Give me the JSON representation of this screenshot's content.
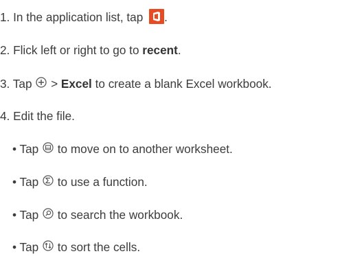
{
  "steps": [
    {
      "prefix": "1. In the application list, tap ",
      "suffix": ".",
      "icon": "office-icon"
    },
    {
      "prefix": "2. Flick left or right to go to ",
      "bold": "recent",
      "suffix": "."
    },
    {
      "prefix": "3. Tap ",
      "middle": " > ",
      "bold": "Excel",
      "suffix": " to create a blank Excel workbook.",
      "icon": "add-circle-icon"
    },
    {
      "text": "4. Edit the file."
    }
  ],
  "bullets": [
    {
      "prefix": "• Tap ",
      "suffix": " to move on to another worksheet.",
      "icon": "worksheet-icon"
    },
    {
      "prefix": "• Tap ",
      "suffix": " to use a function.",
      "icon": "function-sigma-icon"
    },
    {
      "prefix": "• Tap ",
      "suffix": " to search the workbook.",
      "icon": "search-icon"
    },
    {
      "prefix": "• Tap ",
      "suffix": " to sort the cells.",
      "icon": "sort-icon"
    }
  ],
  "colors": {
    "text": "#3c3c3c",
    "office_icon": "#e84a21"
  }
}
